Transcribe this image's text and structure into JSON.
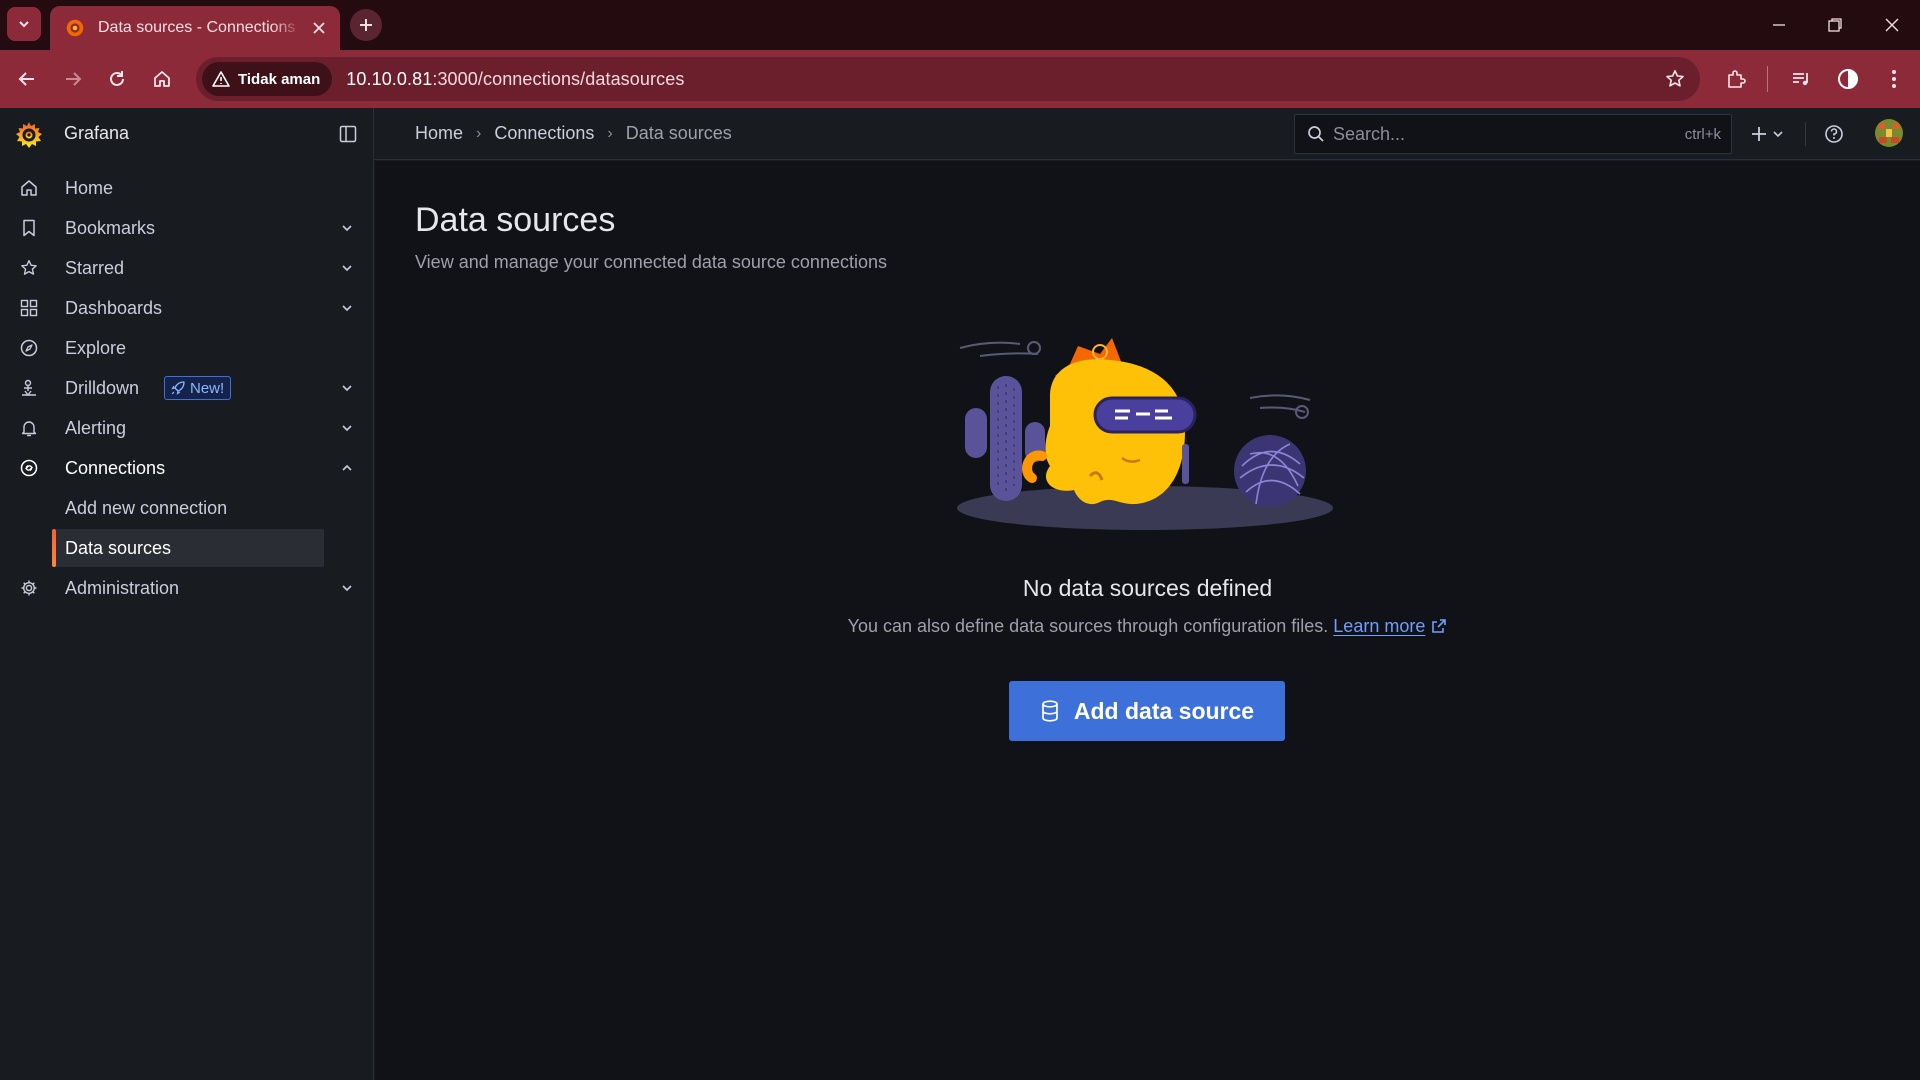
{
  "browser": {
    "tab_title": "Data sources - Connections - Grafana",
    "security_label": "Tidak aman",
    "url_host": "10.10.0.81",
    "url_rest": ":3000/connections/datasources",
    "theme_color": "#8d2a3a"
  },
  "app": {
    "brand": "Grafana",
    "accent": "#f55f3e",
    "primary": "#3d71d9"
  },
  "breadcrumbs": {
    "home": "Home",
    "connections": "Connections",
    "current": "Data sources"
  },
  "search": {
    "placeholder": "Search...",
    "shortcut": "ctrl+k"
  },
  "sidebar": {
    "items": [
      {
        "label": "Home",
        "icon": "home-icon"
      },
      {
        "label": "Bookmarks",
        "icon": "bookmark-icon"
      },
      {
        "label": "Starred",
        "icon": "star-icon"
      },
      {
        "label": "Dashboards",
        "icon": "apps-icon"
      },
      {
        "label": "Explore",
        "icon": "compass-icon"
      },
      {
        "label": "Drilldown",
        "icon": "drilldown-icon",
        "badge": "New!"
      },
      {
        "label": "Alerting",
        "icon": "bell-icon"
      },
      {
        "label": "Connections",
        "icon": "link-icon"
      },
      {
        "label": "Administration",
        "icon": "cog-icon"
      }
    ],
    "connections_children": [
      {
        "label": "Add new connection"
      },
      {
        "label": "Data sources"
      }
    ]
  },
  "page": {
    "title": "Data sources",
    "subtitle": "View and manage your connected data source connections"
  },
  "empty_state": {
    "title": "No data sources defined",
    "text": "You can also define data sources through configuration files.",
    "link": "Learn more",
    "button": "Add data source"
  }
}
